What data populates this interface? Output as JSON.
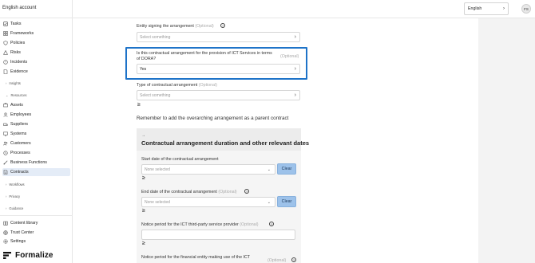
{
  "sidebar": {
    "account": "English account",
    "items_top": [
      {
        "label": "Tasks",
        "icon": "tasks-icon"
      },
      {
        "label": "Frameworks",
        "icon": "frameworks-icon"
      },
      {
        "label": "Policies",
        "icon": "policies-icon"
      },
      {
        "label": "Risks",
        "icon": "risks-icon"
      },
      {
        "label": "Incidents",
        "icon": "incidents-icon"
      },
      {
        "label": "Evidence",
        "icon": "evidence-icon"
      }
    ],
    "groups": {
      "insights": "Insights",
      "resources": "Resources",
      "workflows": "Workflows",
      "privacy": "Privacy",
      "guidance": "Guidance"
    },
    "items_resources": [
      {
        "label": "Assets",
        "icon": "assets-icon"
      },
      {
        "label": "Employees",
        "icon": "employees-icon"
      },
      {
        "label": "Suppliers",
        "icon": "suppliers-icon"
      },
      {
        "label": "Systems",
        "icon": "systems-icon"
      },
      {
        "label": "Customers",
        "icon": "customers-icon"
      },
      {
        "label": "Processes",
        "icon": "processes-icon"
      },
      {
        "label": "Business Functions",
        "icon": "business-functions-icon"
      },
      {
        "label": "Contracts",
        "icon": "contracts-icon",
        "active": true
      }
    ],
    "items_bottom": [
      {
        "label": "Content library",
        "icon": "content-library-icon"
      },
      {
        "label": "Trust Center",
        "icon": "trust-center-icon"
      },
      {
        "label": "Settings",
        "icon": "settings-icon"
      }
    ],
    "logo_text": "Formalize"
  },
  "topbar": {
    "language": "English",
    "avatar_initials": "FS"
  },
  "form": {
    "optional": "(Optional)",
    "entity_signing": {
      "label": "Entity signing the arrangement",
      "placeholder": "Select something"
    },
    "dora": {
      "label_line1": "Is this contractual arrangement for the provision of ICT Services in terms",
      "label_line2": "of DORA?",
      "value": "Yes"
    },
    "type": {
      "label": "Type of contractual arrangement",
      "placeholder": "Select something"
    },
    "gt_symbol": "≥",
    "reminder": "Remember to add the overarching arrangement as a parent contract",
    "section": {
      "arrow": "→",
      "title": "Contractual arrangement duration and other relevant dates"
    },
    "start_date": {
      "label": "Start date of the contractual arrangement",
      "placeholder": "None selected",
      "clear": "Clear"
    },
    "end_date": {
      "label": "End date of the contractual arrangement",
      "placeholder": "None selected",
      "clear": "Clear"
    },
    "notice_ict": {
      "label": "Notice period for the ICT third-party service provider"
    },
    "notice_fin": {
      "label": "Notice period for the financial entity making use of the ICT"
    }
  },
  "colors": {
    "accent": "#1e73c8",
    "clear_button": "#9dc2ea",
    "active_nav": "#e4ecf7"
  }
}
